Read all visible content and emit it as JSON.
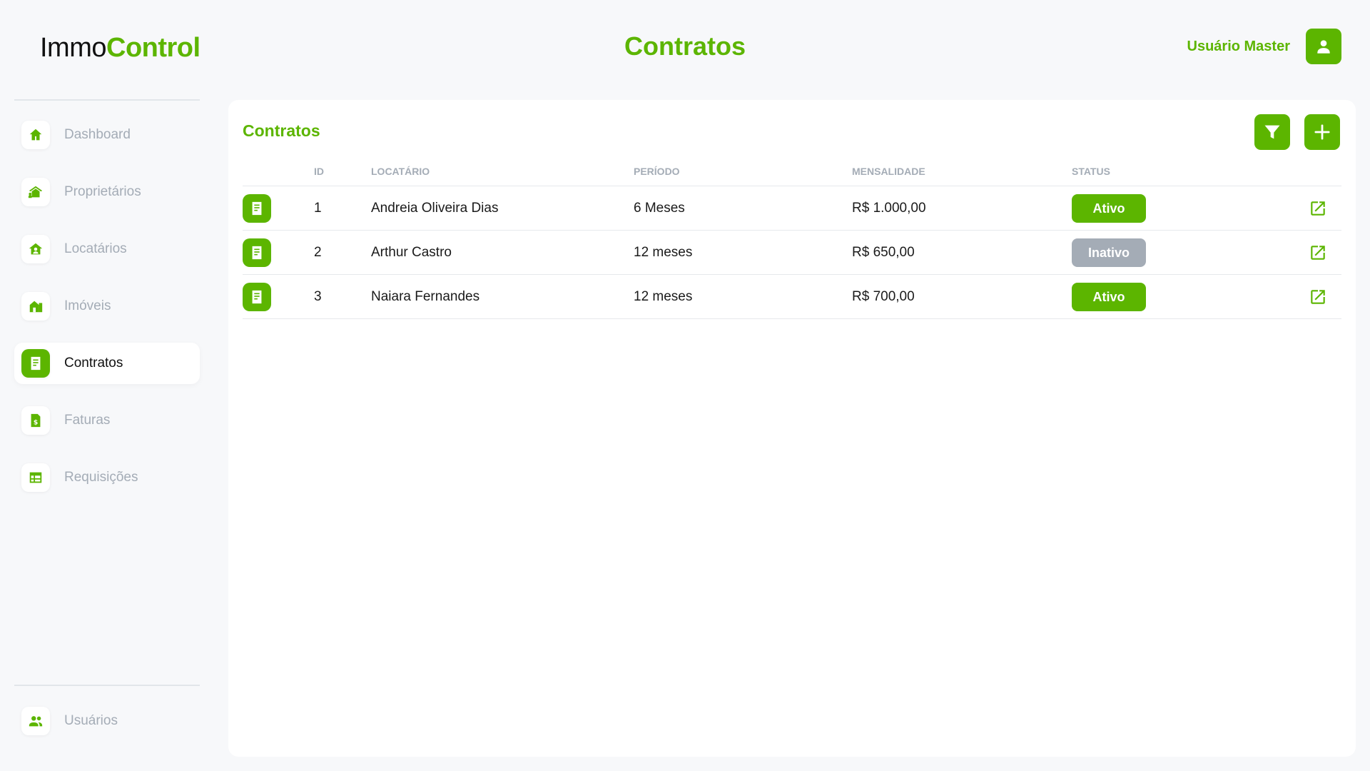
{
  "brand": {
    "part1": "Immo",
    "part2": "Control"
  },
  "header": {
    "title": "Contratos",
    "user_name": "Usuário Master"
  },
  "sidebar": {
    "items": [
      {
        "label": "Dashboard",
        "icon": "home-icon"
      },
      {
        "label": "Proprietários",
        "icon": "owner-icon"
      },
      {
        "label": "Locatários",
        "icon": "tenant-icon"
      },
      {
        "label": "Imóveis",
        "icon": "building-icon"
      },
      {
        "label": "Contratos",
        "icon": "contract-icon",
        "active": true
      },
      {
        "label": "Faturas",
        "icon": "invoice-icon"
      },
      {
        "label": "Requisições",
        "icon": "table-icon"
      }
    ],
    "bottom_item": {
      "label": "Usuários",
      "icon": "users-icon"
    }
  },
  "main": {
    "card_title": "Contratos",
    "columns": [
      "",
      "ID",
      "LOCATÁRIO",
      "PERÍODO",
      "MENSALIDADE",
      "STATUS",
      ""
    ],
    "rows": [
      {
        "id": "1",
        "tenant": "Andreia Oliveira Dias",
        "period": "6 Meses",
        "rent": "R$ 1.000,00",
        "status": "Ativo"
      },
      {
        "id": "2",
        "tenant": "Arthur Castro",
        "period": "12 meses",
        "rent": "R$ 650,00",
        "status": "Inativo"
      },
      {
        "id": "3",
        "tenant": "Naiara Fernandes",
        "period": "12 meses",
        "rent": "R$ 700,00",
        "status": "Ativo"
      }
    ]
  },
  "colors": {
    "accent": "#5cb500",
    "muted": "#a4acb6",
    "background": "#f7f8fa"
  }
}
